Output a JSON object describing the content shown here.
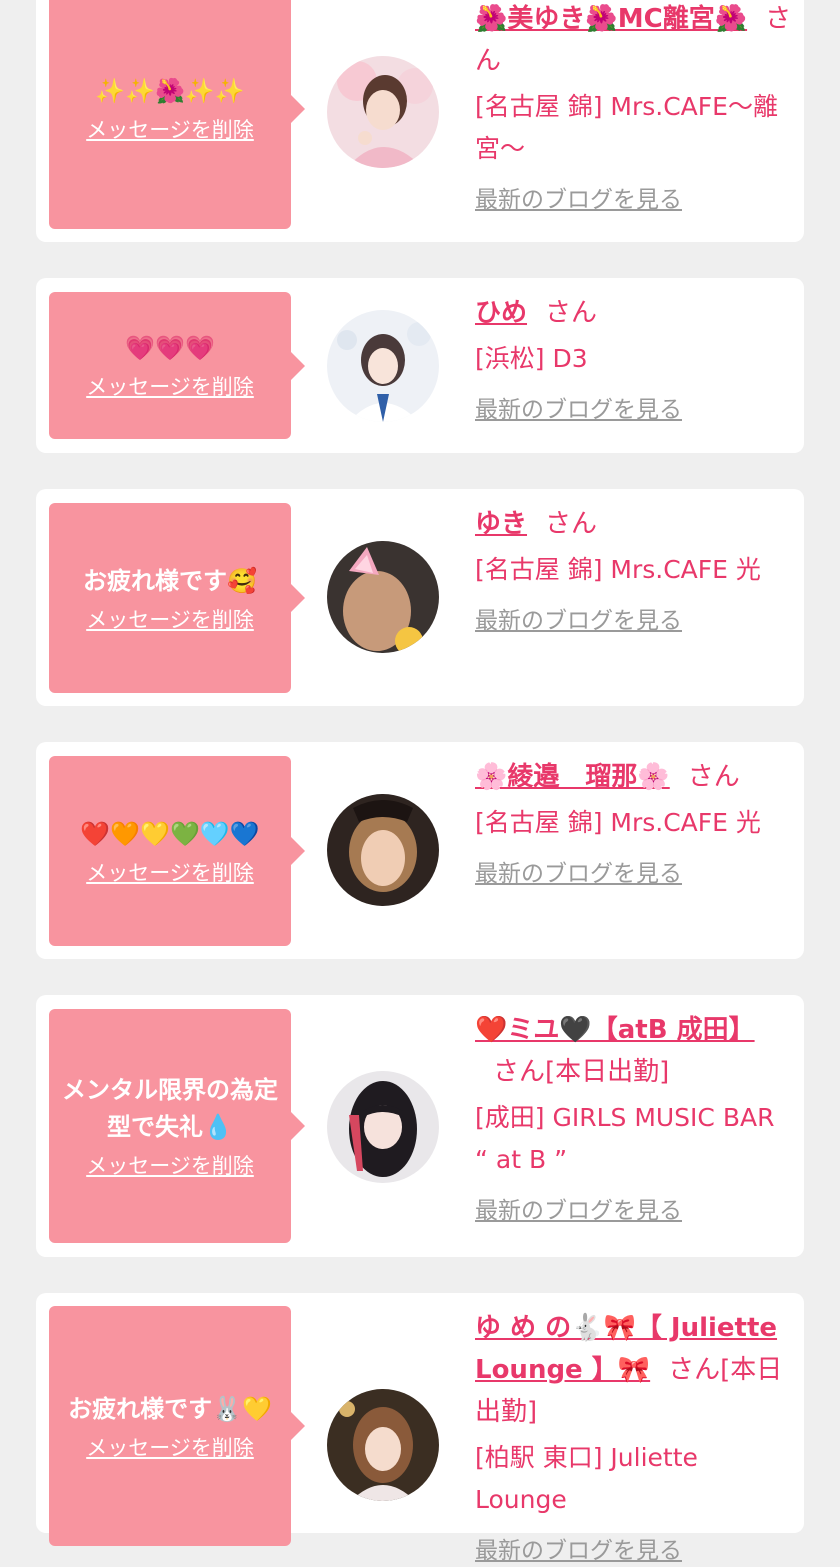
{
  "cards": [
    {
      "message": "✨✨🌺✨✨",
      "delete_label": "メッセージを削除",
      "name": "🌺美ゆき🌺MC離宮🌺",
      "san": "さん",
      "extra": "",
      "shop": "[名古屋 錦] Mrs.CAFE〜離宮〜",
      "blog_label": "最新のブログを見る"
    },
    {
      "message": "💗💗💗",
      "delete_label": "メッセージを削除",
      "name": "ひめ",
      "san": "さん",
      "extra": "",
      "shop": "[浜松] D3",
      "blog_label": "最新のブログを見る"
    },
    {
      "message": "お疲れ様です🥰",
      "delete_label": "メッセージを削除",
      "name": "ゆき",
      "san": "さん",
      "extra": "",
      "shop": "[名古屋 錦] Mrs.CAFE 光",
      "blog_label": "最新のブログを見る"
    },
    {
      "message": "❤️🧡💛💚🩵💙",
      "delete_label": "メッセージを削除",
      "name": "🌸綾邉　瑠那🌸",
      "san": "さん",
      "extra": "",
      "shop": "[名古屋 錦] Mrs.CAFE 光",
      "blog_label": "最新のブログを見る"
    },
    {
      "message": "メンタル限界の為定型で失礼💧",
      "delete_label": "メッセージを削除",
      "name": "❤️ミユ🖤【atB 成田】",
      "san": "さん",
      "extra": "[本日出勤]",
      "shop": "[成田] GIRLS MUSIC BAR “ at B ”",
      "blog_label": "最新のブログを見る"
    },
    {
      "message": "お疲れ様です🐰💛",
      "delete_label": "メッセージを削除",
      "name": "ゆ め の🐇🎀【 Juliette Lounge 】🎀",
      "san": "さん",
      "extra": "[本日出勤]",
      "shop": "[柏駅 東口] Juliette Lounge",
      "blog_label": "最新のブログを見る"
    }
  ],
  "colors": {
    "bubble": "#f8949f",
    "accent": "#e8386a",
    "muted": "#9a9a9a",
    "background": "#efefef"
  }
}
